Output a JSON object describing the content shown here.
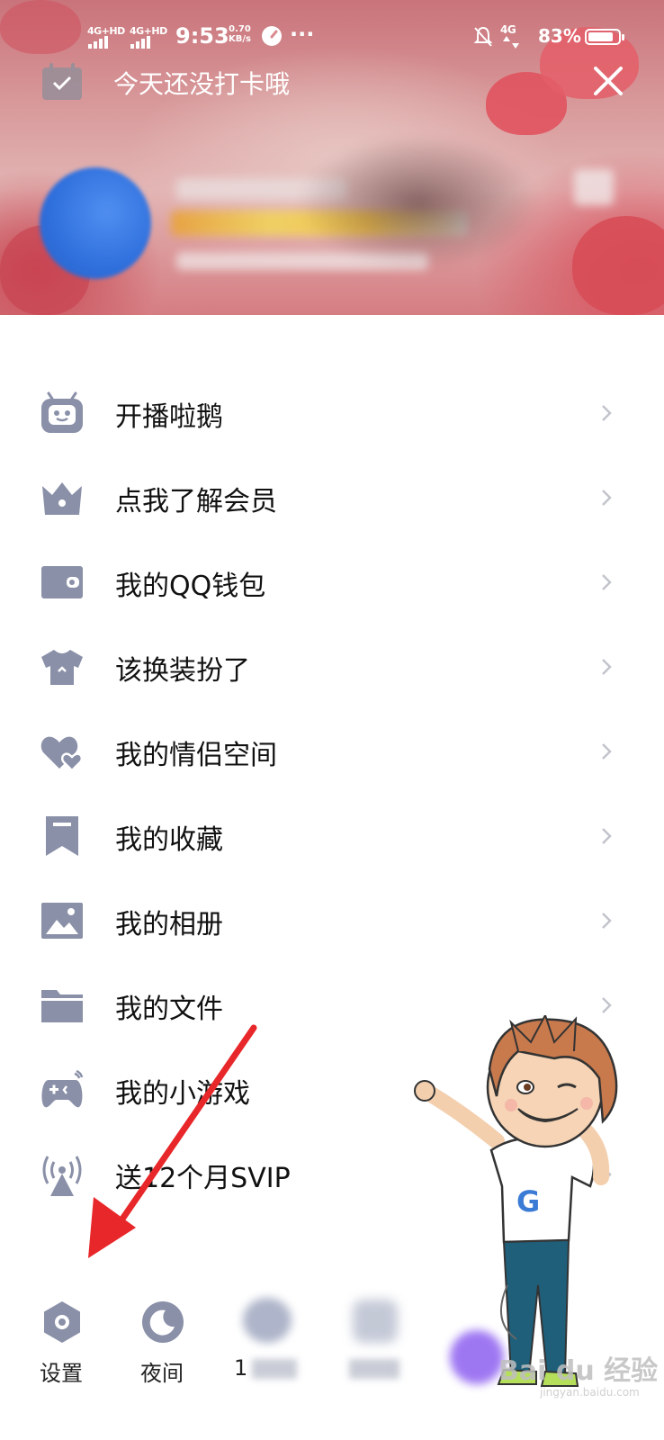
{
  "status_bar": {
    "network_1": "4G+HD",
    "network_2": "4G+HD",
    "time": "9:53",
    "speed_value": "0.70",
    "speed_unit": "KB/s",
    "more": "···",
    "network_3": "4G",
    "battery_percent": "83%",
    "battery_level": 0.83
  },
  "header": {
    "checkin_text": "今天还没打卡哦"
  },
  "menu": {
    "items": [
      {
        "label": "开播啦鹅",
        "icon": "tv-robot-icon"
      },
      {
        "label": "点我了解会员",
        "icon": "crown-icon"
      },
      {
        "label": "我的QQ钱包",
        "icon": "wallet-icon"
      },
      {
        "label": "该换装扮了",
        "icon": "shirt-icon"
      },
      {
        "label": "我的情侣空间",
        "icon": "hearts-icon"
      },
      {
        "label": "我的收藏",
        "icon": "bookmark-icon"
      },
      {
        "label": "我的相册",
        "icon": "image-icon"
      },
      {
        "label": "我的文件",
        "icon": "folder-icon"
      },
      {
        "label": "我的小游戏",
        "icon": "gamepad-icon"
      },
      {
        "label": "送12个月SVIP",
        "icon": "broadcast-tower-icon"
      }
    ]
  },
  "bottom_bar": {
    "settings_label": "设置",
    "night_label": "夜间",
    "third_label_partial": "1"
  },
  "watermark": {
    "text": "Bai du 经验",
    "sub": "jingyan.baidu.com"
  },
  "colors": {
    "icon_gray": "#8a90a8",
    "arrow_red": "#e8272a",
    "text": "#111111"
  }
}
